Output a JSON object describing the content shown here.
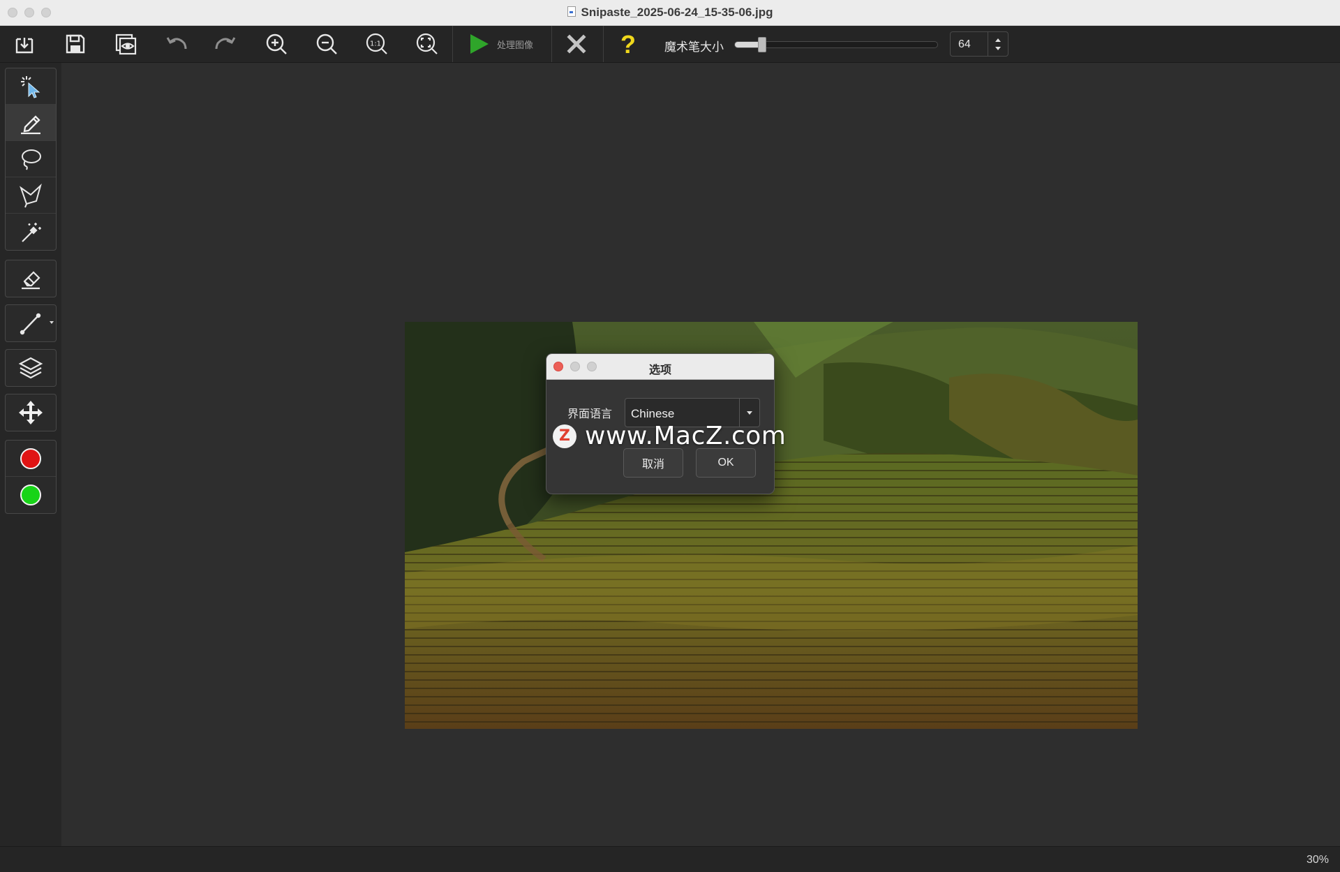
{
  "window": {
    "title": "Snipaste_2025-06-24_15-35-06.jpg"
  },
  "toolbar": {
    "open_icon": "open-file-icon",
    "save_icon": "save-icon",
    "preview_icon": "preview-icon",
    "undo_icon": "undo-icon",
    "redo_icon": "redo-icon",
    "zoom_in_icon": "zoom-in-icon",
    "zoom_out_icon": "zoom-out-icon",
    "actual_size_icon": "actual-size-icon",
    "fit_icon": "fit-to-window-icon",
    "process_label": "处理图像",
    "clear_icon": "close-icon",
    "help_icon": "help-icon",
    "magic_size_label": "魔术笔大小",
    "magic_size_value": "64",
    "magic_size_fraction": 0.12
  },
  "sidebar": {
    "tools": [
      "smart-select-icon",
      "pen-icon",
      "lasso-icon",
      "polygon-lasso-icon",
      "magic-wand-icon",
      "eraser-icon",
      "line-icon",
      "layers-icon",
      "move-icon"
    ],
    "colors": {
      "foreground": "#e01414",
      "background": "#18d418"
    }
  },
  "dialog": {
    "title": "选项",
    "language_label": "界面语言",
    "language_value": "Chinese",
    "cancel_label": "取消",
    "ok_label": "OK"
  },
  "watermark": {
    "logo_letter": "Z",
    "text": "www.MacZ.com"
  },
  "status": {
    "zoom": "30%"
  },
  "colors": {
    "accent_play": "#2fa52a",
    "help": "#f0d81c"
  }
}
